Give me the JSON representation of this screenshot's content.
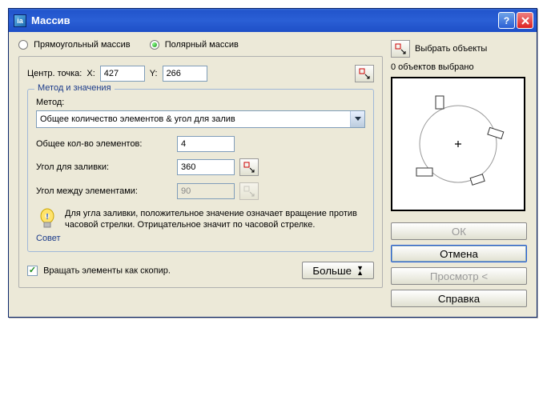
{
  "title": "Массив",
  "radios": {
    "rect": "Прямоугольный массив",
    "polar": "Полярный массив"
  },
  "center": {
    "label": "Центр. точка:",
    "x_label": "X:",
    "y_label": "Y:",
    "x": "427",
    "y": "266"
  },
  "fieldset_title": "Метод и значения",
  "method_label": "Метод:",
  "method_value": "Общее количество элементов & угол для залив",
  "total_label": "Общее кол-во элементов:",
  "total_value": "4",
  "fill_angle_label": "Угол для заливки:",
  "fill_angle_value": "360",
  "between_label": "Угол между элементами:",
  "between_value": "90",
  "tip_label": "Совет",
  "tip_text": "Для угла заливки, положительное значение означает вращение против часовой стрелки.  Отрицательное значит по часовой стрелке.",
  "rotate_check": "Вращать элементы как скопир.",
  "more_btn": "Больше",
  "right": {
    "select_objects": "Выбрать объекты",
    "status": "0 объектов выбрано",
    "ok": "ОК",
    "cancel": "Отмена",
    "preview": "Просмотр <",
    "help": "Справка"
  }
}
